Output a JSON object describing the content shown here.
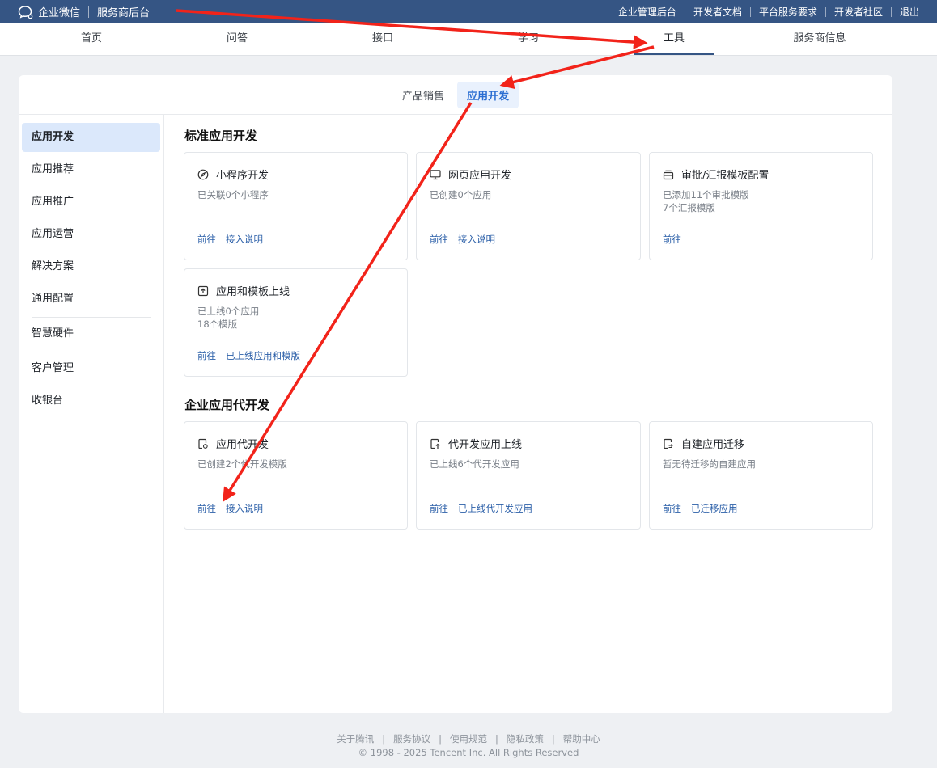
{
  "topbar": {
    "brand": "企业微信",
    "subtitle": "服务商后台",
    "links": [
      "企业管理后台",
      "开发者文档",
      "平台服务要求",
      "开发者社区",
      "退出"
    ]
  },
  "mainnav": {
    "items": [
      "首页",
      "问答",
      "接口",
      "学习",
      "工具",
      "服务商信息"
    ],
    "active": "工具"
  },
  "subtabs": {
    "items": [
      "产品销售",
      "应用开发"
    ],
    "active": "应用开发"
  },
  "sidebar": {
    "items": [
      "应用开发",
      "应用推荐",
      "应用推广",
      "应用运营",
      "解决方案",
      "通用配置",
      "智慧硬件",
      "客户管理",
      "收银台"
    ],
    "active": "应用开发"
  },
  "sections": [
    {
      "title": "标准应用开发",
      "cards": [
        {
          "icon": "compass-icon",
          "title": "小程序开发",
          "desc": "已关联0个小程序",
          "links": [
            "前往",
            "接入说明"
          ]
        },
        {
          "icon": "monitor-icon",
          "title": "网页应用开发",
          "desc": "已创建0个应用",
          "links": [
            "前往",
            "接入说明"
          ]
        },
        {
          "icon": "inbox-icon",
          "title": "审批/汇报模板配置",
          "desc": "已添加11个审批模版\n7个汇报模版",
          "links": [
            "前往"
          ]
        },
        {
          "icon": "upload-icon",
          "title": "应用和模板上线",
          "desc": "已上线0个应用\n18个模版",
          "links": [
            "前往",
            "已上线应用和模版"
          ]
        }
      ]
    },
    {
      "title": "企业应用代开发",
      "cards": [
        {
          "icon": "doc-gear-icon",
          "title": "应用代开发",
          "desc": "已创建2个代开发模版",
          "links": [
            "前往",
            "接入说明"
          ]
        },
        {
          "icon": "doc-upload-icon",
          "title": "代开发应用上线",
          "desc": "已上线6个代开发应用",
          "links": [
            "前往",
            "已上线代开发应用"
          ]
        },
        {
          "icon": "doc-migrate-icon",
          "title": "自建应用迁移",
          "desc": "暂无待迁移的自建应用",
          "links": [
            "前往",
            "已迁移应用"
          ]
        }
      ]
    }
  ],
  "footer": {
    "links": [
      "关于腾讯",
      "服务协议",
      "使用规范",
      "隐私政策",
      "帮助中心"
    ],
    "copyright": "© 1998 - 2025 Tencent Inc. All Rights Reserved"
  },
  "colors": {
    "topbar": "#355584",
    "accent": "#2b6ed2",
    "link": "#2b5fa8",
    "arrow": "#f2231a"
  }
}
